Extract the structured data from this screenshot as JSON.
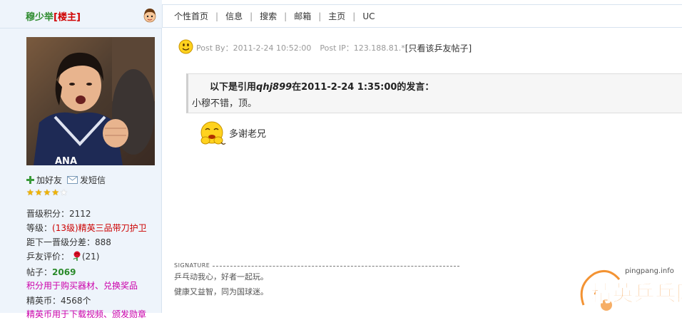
{
  "user": {
    "name": "穆少举",
    "badge": "[楼主]",
    "add_friend": "加好友",
    "send_message": "发短信",
    "stars_filled": 4,
    "stars_total": 5,
    "level_points": "晋级积分：2112",
    "level_label": "等级：",
    "level_value": "(13级)精英三品带刀护卫",
    "next_level": "距下一晋级分差：888",
    "rating_label": "乒友评价：",
    "rating_value": "(21)",
    "posts_label": "帖子：",
    "posts_value": "2069",
    "points_note": "积分用于购买器材、兑换奖品",
    "coins": "精英币：4568个",
    "coins_note": "精英币用于下载视频、颁发勋章"
  },
  "nav": {
    "items": [
      "个性首页",
      "信息",
      "搜索",
      "邮箱",
      "主页",
      "UC"
    ]
  },
  "post": {
    "post_by": "Post By：2011-2-24 10:52:00",
    "post_ip": "Post IP：123.188.81.*",
    "only_this_user": "[只看该乒友帖子]",
    "quote_prefix": "以下是引用",
    "quote_user": "qhj899",
    "quote_middle": "在2011-2-24 1:35:00的发言：",
    "quote_body": "小穆不错，顶。",
    "reply": "多谢老兄"
  },
  "signature": {
    "label": "SIGNATURE",
    "line1": "乒乓动我心，好者一起玩。",
    "line2": "健康又益智，同为国球迷。"
  },
  "watermark": {
    "domain": "pingpang.info",
    "brand": "精英乒乓网"
  },
  "colors": {
    "sidebar_bg": "#eef4fb",
    "username": "#2e8b2e",
    "badge": "#d00000",
    "level": "#cc0000",
    "posts": "#2a8a2a",
    "note": "#cc00aa",
    "watermark_orange": "#f07800"
  }
}
